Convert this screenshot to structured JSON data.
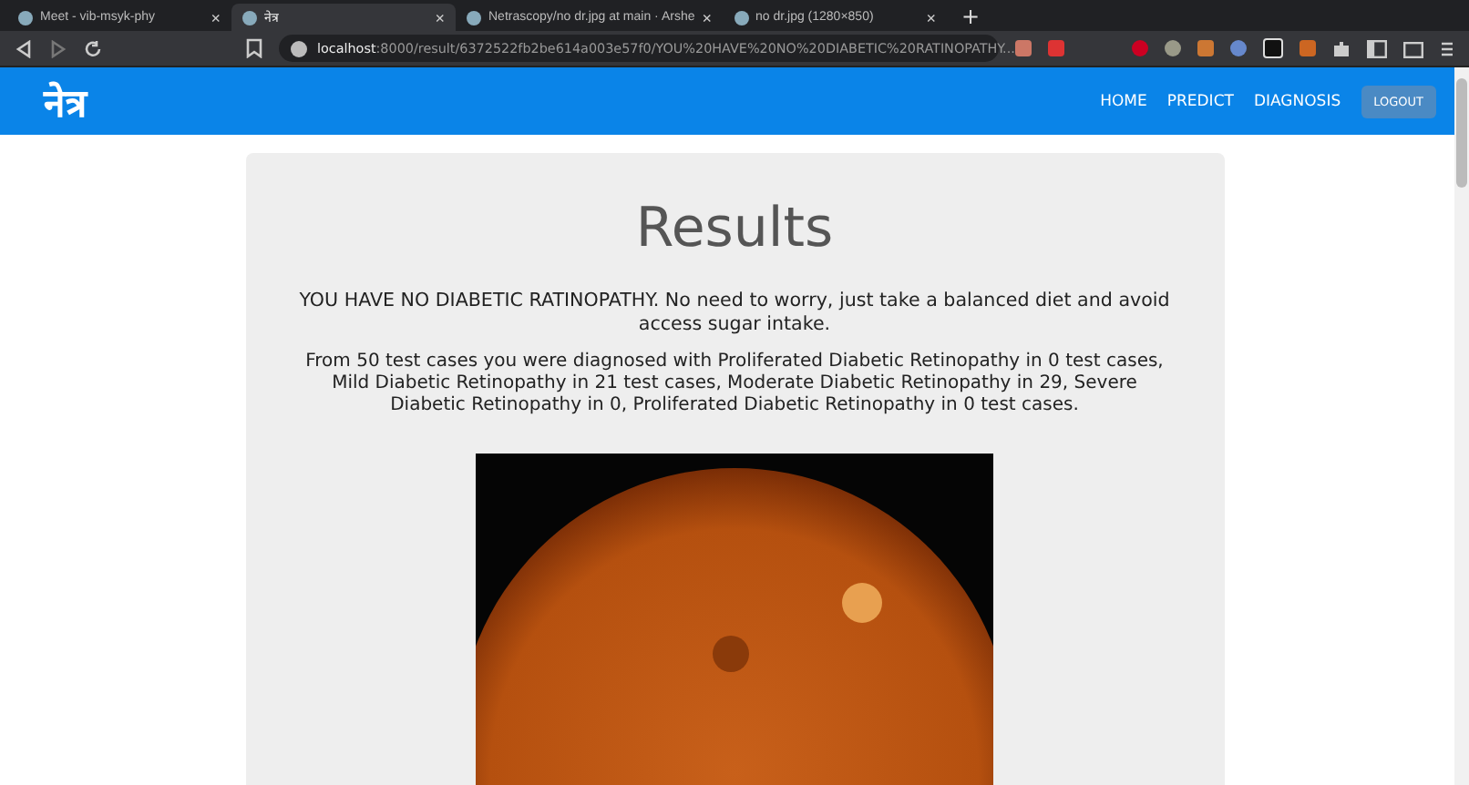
{
  "browser": {
    "tabs": [
      {
        "label": "Meet - vib-msyk-phy",
        "selected": false
      },
      {
        "label": "नेत्र",
        "selected": true
      },
      {
        "label": "Netrascopy/no dr.jpg at main · Arshe",
        "selected": false
      },
      {
        "label": "no dr.jpg (1280×850)",
        "selected": false
      }
    ],
    "tab_close": "×",
    "new_tab": "+",
    "address": {
      "host": "localhost",
      "path": ":8000/result/6372522fb2be614a003e57f0/YOU%20HAVE%20NO%20DIABETIC%20RATINOPATHY..."
    }
  },
  "navbar": {
    "logo": "नेत्र",
    "links": [
      "HOME",
      "PREDICT",
      "DIAGNOSIS"
    ],
    "button": "LOGOUT"
  },
  "result": {
    "title": "Results",
    "message": "YOU HAVE NO DIABETIC RATINOPATHY. No need to worry, just take a balanced diet and avoid access sugar intake.",
    "details": "From 50 test cases you were diagnosed with Proliferated Diabetic Retinopathy in 0 test cases, Mild Diabetic Retinopathy in 21 test cases, Moderate Diabetic Retinopathy in 29, Severe Diabetic Retinopathy in 0, Proliferated Diabetic Retinopathy in 0 test cases."
  }
}
